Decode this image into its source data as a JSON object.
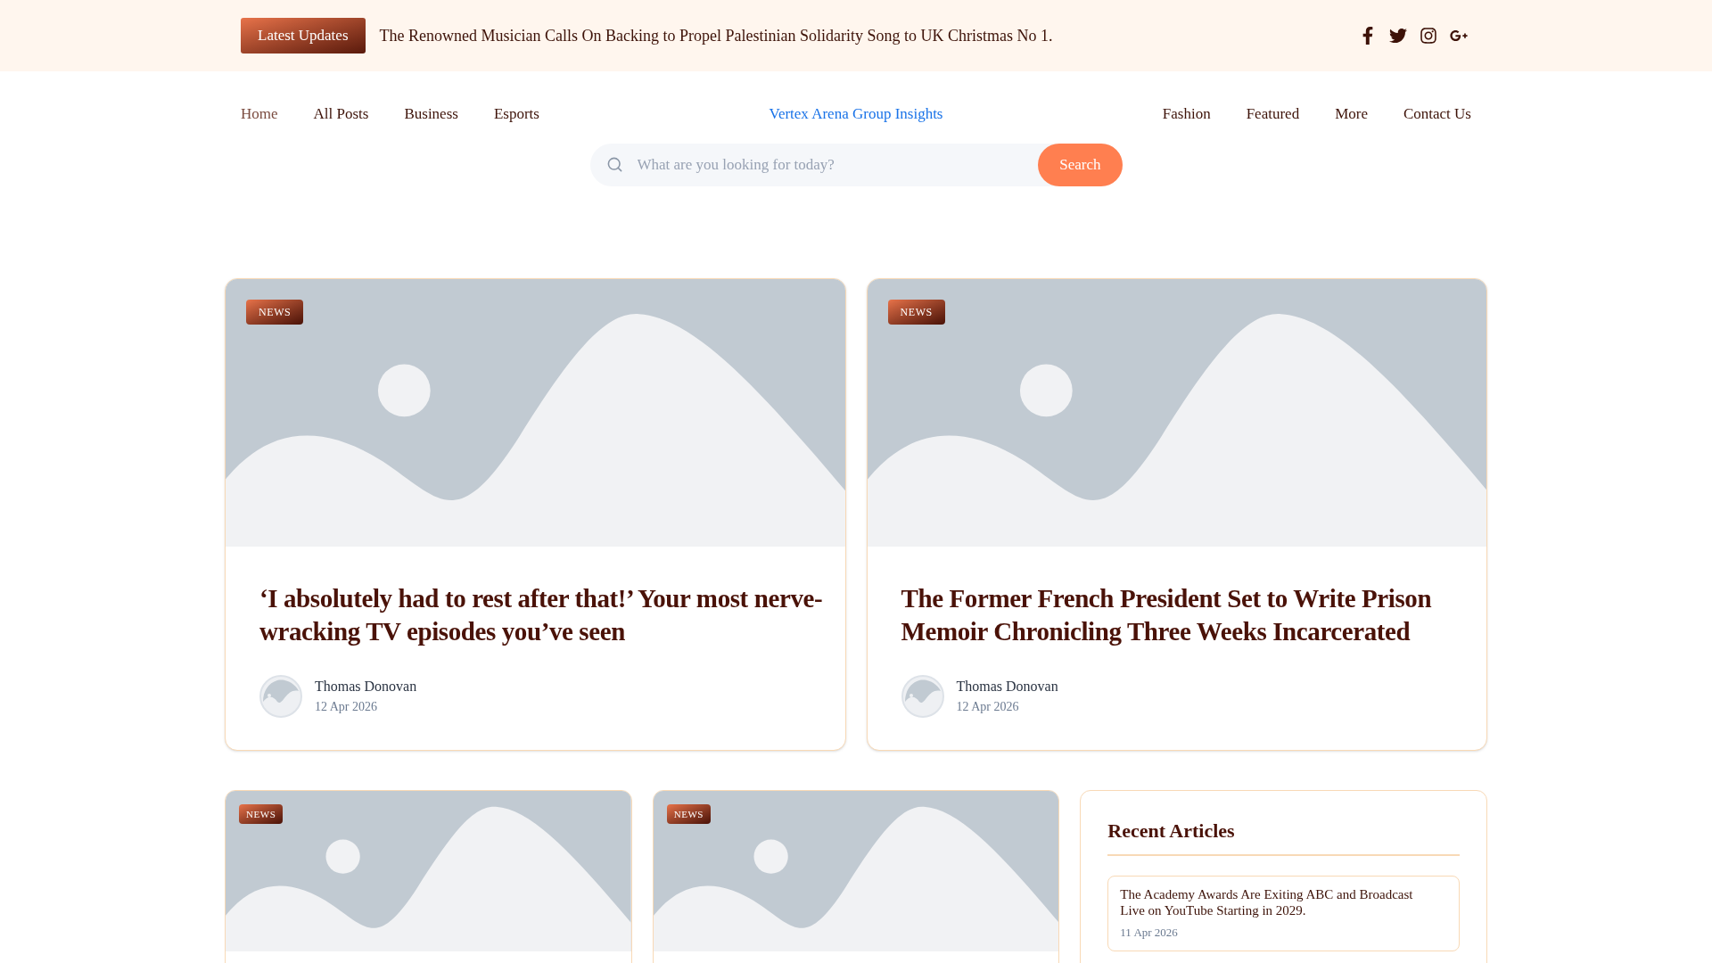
{
  "ticker": {
    "label": "Latest Updates",
    "headline": "The Renowned Musician Calls On Backing to Propel Palestinian Solidarity Song to UK Christmas No 1."
  },
  "social": [
    {
      "kind": "facebook"
    },
    {
      "kind": "twitter"
    },
    {
      "kind": "instagram"
    },
    {
      "kind": "googleplus"
    }
  ],
  "nav": {
    "left": [
      {
        "label": "Home",
        "selected": true
      },
      {
        "label": "All Posts",
        "selected": false
      },
      {
        "label": "Business",
        "selected": false
      },
      {
        "label": "Esports",
        "selected": false
      }
    ],
    "brand": "Vertex Arena Group Insights",
    "right": [
      {
        "label": "Fashion",
        "selected": false
      },
      {
        "label": "Featured",
        "selected": false
      },
      {
        "label": "More",
        "selected": false
      },
      {
        "label": "Contact Us",
        "selected": false
      }
    ]
  },
  "search": {
    "placeholder": "What are you looking for today?",
    "button": "Search"
  },
  "featured": [
    {
      "tag": "NEWS",
      "title": "‘I absolutely had to rest after that!’ Your most nerve-wracking TV episodes you’ve seen",
      "author": "Thomas Donovan",
      "date": "12 Apr 2026"
    },
    {
      "tag": "NEWS",
      "title": "The Former French President Set to Write Prison Memoir Chronicling Three Weeks Incarcerated",
      "author": "Thomas Donovan",
      "date": "12 Apr 2026"
    }
  ],
  "grid": [
    {
      "tag": "NEWS"
    },
    {
      "tag": "NEWS"
    }
  ],
  "recent": {
    "title": "Recent Articles",
    "items": [
      {
        "title": "The Academy Awards Are Exiting ABC and Broadcast Live on YouTube Starting in 2029.",
        "date": "11 Apr 2026"
      }
    ]
  }
}
